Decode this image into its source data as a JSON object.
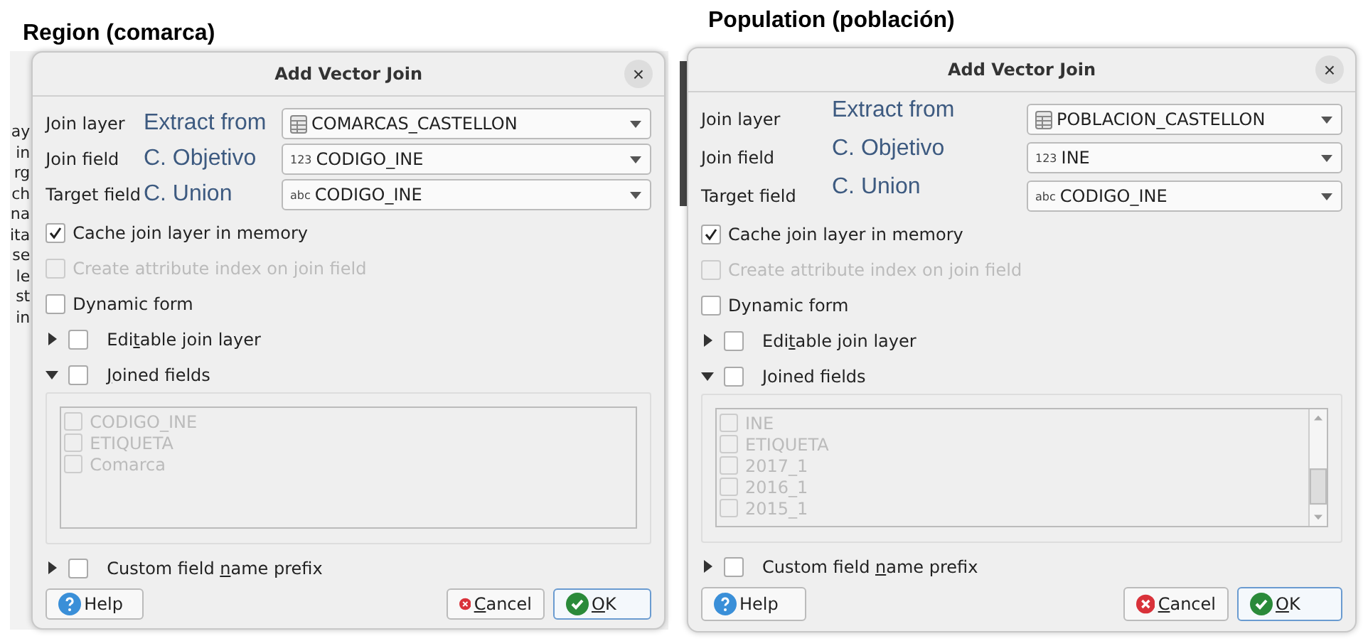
{
  "panels": [
    {
      "heading": "Region (comarca)",
      "background_window": {
        "fragments": [
          "ay",
          "in",
          "rg",
          "ch",
          "na",
          "ita",
          "se",
          "le",
          "st",
          "in"
        ]
      },
      "dialog": {
        "title": "Add Vector Join",
        "close": "×",
        "rows": [
          {
            "label": "Join layer",
            "note": "Extract from",
            "kind": "layer",
            "value": "COMARCAS_CASTELLON"
          },
          {
            "label": "Join field",
            "note": "C. Objetivo",
            "kind": "number",
            "badge": "123",
            "value": "CODIGO_INE"
          },
          {
            "label": "Target field",
            "note": "C. Union",
            "kind": "text",
            "badge": "abc",
            "value": "CODIGO_INE"
          }
        ],
        "options": [
          {
            "label": "Cache join layer in memory",
            "checked": true,
            "disabled": false
          },
          {
            "label": "Create attribute index on join field",
            "checked": false,
            "disabled": true
          },
          {
            "label": "Dynamic form",
            "checked": false,
            "disabled": false
          }
        ],
        "sections": [
          {
            "parts": [
              {
                "text": "Edi"
              },
              {
                "text": "t",
                "underline": true
              },
              {
                "text": "able join layer"
              }
            ],
            "expanded": false,
            "checked": false
          },
          {
            "parts": [
              {
                "text": "J",
                "underline": true
              },
              {
                "text": "oined fields"
              }
            ],
            "expanded": true,
            "checked": false,
            "fields": [
              {
                "label": "CODIGO_INE",
                "checked": false
              },
              {
                "label": "ETIQUETA",
                "checked": false
              },
              {
                "label": "Comarca",
                "checked": false
              }
            ],
            "disabled": true
          },
          {
            "parts": [
              {
                "text": "Custom field "
              },
              {
                "text": "n",
                "underline": true
              },
              {
                "text": "ame prefix"
              }
            ],
            "expanded": false,
            "checked": false
          }
        ],
        "buttons": [
          {
            "kind": "help",
            "parts": [
              {
                "text": "Help"
              }
            ]
          },
          {
            "kind": "cancel",
            "parts": [
              {
                "text": "C",
                "underline": true
              },
              {
                "text": "ancel"
              }
            ]
          },
          {
            "kind": "ok",
            "parts": [
              {
                "text": "O",
                "underline": true
              },
              {
                "text": "K"
              }
            ]
          }
        ]
      }
    },
    {
      "heading": "Population (población)",
      "dialog": {
        "title": "Add Vector Join",
        "close": "×",
        "rows": [
          {
            "label": "Join layer",
            "note": "Extract from",
            "kind": "layer",
            "value": "POBLACION_CASTELLON"
          },
          {
            "label": "Join field",
            "note": "C. Objetivo",
            "kind": "number",
            "badge": "123",
            "value": "INE"
          },
          {
            "label": "Target field",
            "note": "C. Union",
            "kind": "text",
            "badge": "abc",
            "value": "CODIGO_INE"
          }
        ],
        "options": [
          {
            "label": "Cache join layer in memory",
            "checked": true,
            "disabled": false
          },
          {
            "label": "Create attribute index on join field",
            "checked": false,
            "disabled": true
          },
          {
            "label": "Dynamic form",
            "checked": false,
            "disabled": false
          }
        ],
        "sections": [
          {
            "parts": [
              {
                "text": "Edi"
              },
              {
                "text": "t",
                "underline": true
              },
              {
                "text": "able join layer"
              }
            ],
            "expanded": false,
            "checked": false
          },
          {
            "parts": [
              {
                "text": "J",
                "underline": true
              },
              {
                "text": "oined fields"
              }
            ],
            "expanded": true,
            "checked": false,
            "fields": [
              {
                "label": "INE",
                "checked": false
              },
              {
                "label": "ETIQUETA",
                "checked": false
              },
              {
                "label": "2017_1",
                "checked": false
              },
              {
                "label": "2016_1",
                "checked": false
              },
              {
                "label": "2015_1",
                "checked": false
              }
            ],
            "disabled": true,
            "scrollbar": true
          },
          {
            "parts": [
              {
                "text": "Custom field "
              },
              {
                "text": "n",
                "underline": true
              },
              {
                "text": "ame prefix"
              }
            ],
            "expanded": false,
            "checked": false
          }
        ],
        "buttons": [
          {
            "kind": "help",
            "parts": [
              {
                "text": "Help"
              }
            ]
          },
          {
            "kind": "cancel",
            "parts": [
              {
                "text": "C",
                "underline": true
              },
              {
                "text": "ancel"
              }
            ]
          },
          {
            "kind": "ok",
            "parts": [
              {
                "text": "O",
                "underline": true
              },
              {
                "text": "K"
              }
            ]
          }
        ]
      }
    }
  ]
}
